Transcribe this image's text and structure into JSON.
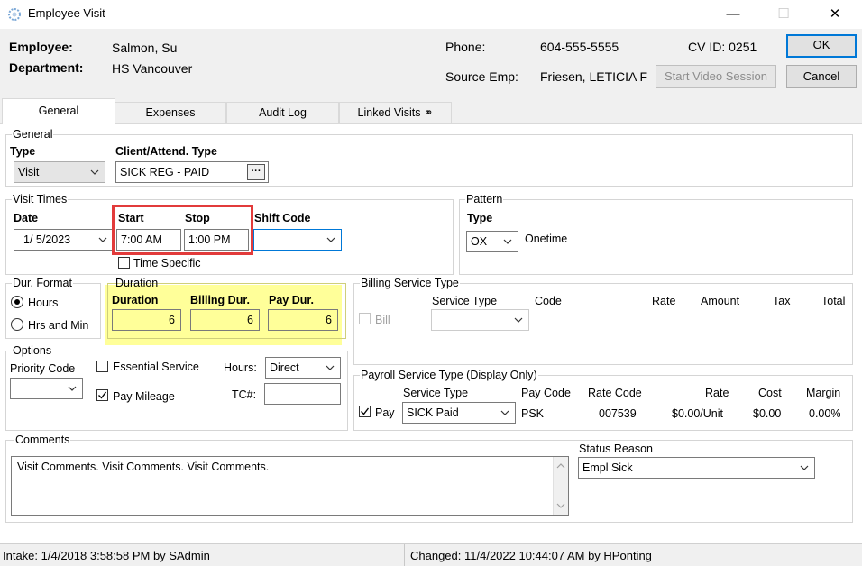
{
  "window": {
    "title": "Employee Visit",
    "minimize": "—",
    "maximize": "☐",
    "close": "✕"
  },
  "header": {
    "employee_label": "Employee:",
    "employee_value": "Salmon, Su",
    "department_label": "Department:",
    "department_value": "HS Vancouver",
    "phone_label": "Phone:",
    "phone_value": "604-555-5555",
    "cvid_label": "CV ID: 0251",
    "source_label": "Source Emp:",
    "source_value": "Friesen, LETICIA F",
    "video_button": "Start Video Session",
    "ok_button": "OK",
    "cancel_button": "Cancel"
  },
  "tabs": [
    {
      "label": "General"
    },
    {
      "label": "Expenses"
    },
    {
      "label": "Audit Log"
    },
    {
      "label": "Linked Visits ⚭"
    }
  ],
  "general": {
    "group_label": "General",
    "type_label": "Type",
    "type_value": "Visit",
    "client_type_label": "Client/Attend. Type",
    "client_type_value": "SICK REG - PAID",
    "ellipsis": "···"
  },
  "visit_times": {
    "group_label": "Visit Times",
    "date_label": "Date",
    "date_value": "1/ 5/2023",
    "start_label": "Start",
    "start_value": "7:00 AM",
    "stop_label": "Stop",
    "stop_value": "1:00 PM",
    "shift_code_label": "Shift Code",
    "shift_code_value": "",
    "time_specific_label": "Time Specific"
  },
  "pattern": {
    "group_label": "Pattern",
    "type_label": "Type",
    "type_value": "OX",
    "type_desc": "Onetime"
  },
  "dur_format": {
    "group_label": "Dur. Format",
    "hours_label": "Hours",
    "hrs_min_label": "Hrs and Min"
  },
  "duration": {
    "group_label": "Duration",
    "duration_label": "Duration",
    "duration_value": "6",
    "billing_label": "Billing Dur.",
    "billing_value": "6",
    "pay_label": "Pay Dur.",
    "pay_value": "6"
  },
  "billing": {
    "group_label": "Billing Service Type",
    "service_type_label": "Service Type",
    "code_label": "Code",
    "rate_label": "Rate",
    "amount_label": "Amount",
    "tax_label": "Tax",
    "total_label": "Total",
    "bill_label": "Bill"
  },
  "options": {
    "group_label": "Options",
    "priority_label": "Priority Code",
    "essential_label": "Essential Service",
    "hours_label": "Hours:",
    "hours_value": "Direct",
    "pay_mileage_label": "Pay Mileage",
    "tc_label": "TC#:",
    "tc_value": ""
  },
  "payroll": {
    "group_label": "Payroll Service Type (Display Only)",
    "service_type_label": "Service Type",
    "pay_code_label": "Pay Code",
    "rate_code_label": "Rate Code",
    "rate_label": "Rate",
    "cost_label": "Cost",
    "margin_label": "Margin",
    "pay_label": "Pay",
    "service_type_value": "SICK Paid",
    "pay_code_value": "PSK",
    "rate_code_value": "007539",
    "rate_value": "$0.00/Unit",
    "cost_value": "$0.00",
    "margin_value": "0.00%"
  },
  "comments": {
    "group_label": "Comments",
    "text": "Visit Comments. Visit Comments. Visit Comments.",
    "status_reason_label": "Status Reason",
    "status_reason_value": "Empl Sick"
  },
  "status_bar": {
    "intake": "Intake: 1/4/2018 3:58:58 PM by SAdmin",
    "changed": "Changed: 11/4/2022 10:44:07 AM by HPonting"
  },
  "colors": {
    "highlight_yellow": "#ffff99",
    "highlight_red": "#e23b3b",
    "ok_border": "#0078d7"
  }
}
